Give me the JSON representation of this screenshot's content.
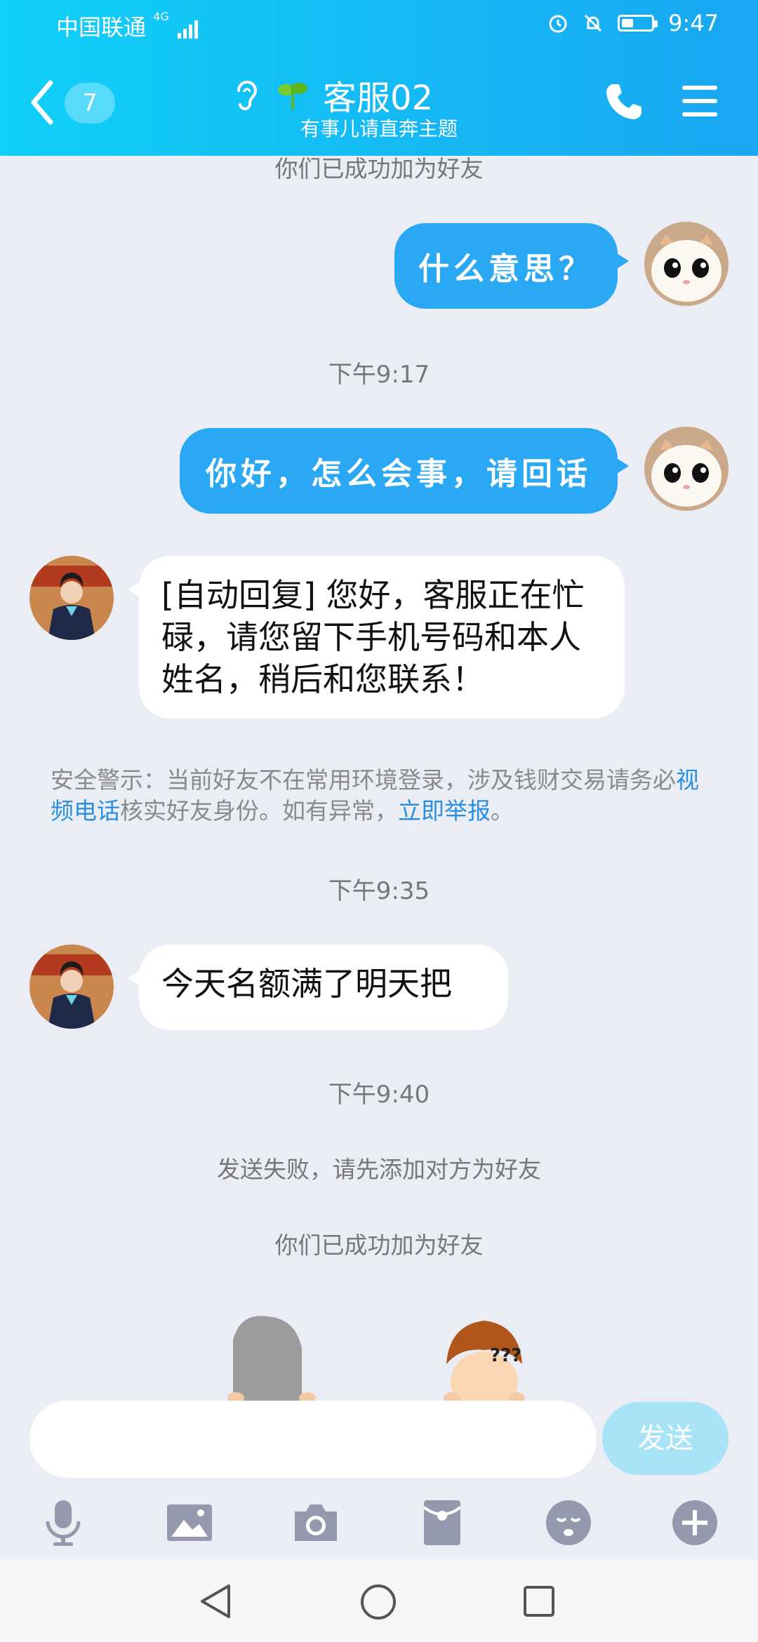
{
  "status_bar": {
    "carrier": "中国联通",
    "network": "4G",
    "time": "9:47"
  },
  "header": {
    "unread_count": "7",
    "title": "客服02",
    "subtitle": "有事儿请直奔主题"
  },
  "messages": {
    "sys1": "你们已成功加为好友",
    "out1": "什么意思？",
    "time1": "下午9:17",
    "out2": "你好，怎么会事，请回话",
    "in1": "[自动回复] 您好，客服正在忙碌，请您留下手机号码和本人姓名，稍后和您联系！",
    "warning": {
      "prefix": "安全警示：当前好友不在常用环境登录，涉及钱财交易请务必",
      "link1": "视频电话",
      "middle": "核实好友身份。如有异常，",
      "link2": "立即举报",
      "suffix": "。"
    },
    "time2": "下午9:35",
    "in2": "今天名额满了明天把",
    "time3": "下午9:40",
    "sys2": "发送失败，请先添加对方为好友",
    "sys3": "你们已成功加为好友"
  },
  "input": {
    "placeholder": "",
    "send_label": "发送"
  },
  "colors": {
    "header_start": "#0fd0f8",
    "header_end": "#1aa6f2",
    "outgoing_bubble": "#2aa8f3",
    "incoming_bubble": "#ffffff",
    "link": "#2a8fe0"
  },
  "icons": [
    "back-arrow-icon",
    "hearing-icon",
    "sprout-icon",
    "phone-icon",
    "menu-icon",
    "microphone-icon",
    "image-icon",
    "camera-icon",
    "red-packet-icon",
    "emoji-icon",
    "plus-icon",
    "nav-back-icon",
    "nav-home-icon",
    "nav-recents-icon"
  ]
}
